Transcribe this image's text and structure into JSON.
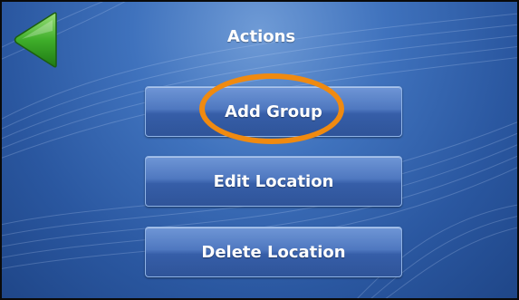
{
  "screen": {
    "title": "Actions"
  },
  "back_button": {
    "icon": "back-arrow-icon",
    "color": "#3fae2a"
  },
  "actions": {
    "add_group_label": "Add Group",
    "edit_location_label": "Edit Location",
    "delete_location_label": "Delete Location"
  },
  "highlight": {
    "color": "#f08a10",
    "target": "Add Group"
  }
}
